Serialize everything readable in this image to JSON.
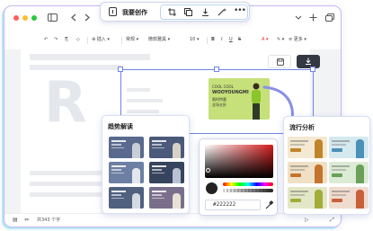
{
  "floating_toolbar": {
    "label": "我要创作"
  },
  "format_toolbar": {
    "insert_label": "插入",
    "font_label": "常规",
    "font_family": "微软雅黑",
    "font_size": "10",
    "more_label": "更多"
  },
  "canvas": {
    "watermark": "R"
  },
  "banner": {
    "line1": "COOL COOL",
    "line2": "WOOYOUNGMI",
    "line3": "限时特惠",
    "line4": "全场五折",
    "colors": {
      "background": "#c6e07a",
      "figure": "#8bc52c"
    }
  },
  "trend_panel": {
    "title": "趋势解读",
    "thumb_colors": [
      "#5a6a8e",
      "#4b5a7a",
      "#6d7fa3",
      "#37445e",
      "#50607f",
      "#7a6f8b"
    ]
  },
  "popular_panel": {
    "title": "流行分析",
    "card_colors": [
      "#f4e9d2",
      "#d6e9ef",
      "#efe0c6",
      "#dcebd5",
      "#e3e7c7",
      "#f0dccf"
    ],
    "accent_colors": [
      "#c0852a",
      "#4a91b7",
      "#c5742b",
      "#6aa05b",
      "#a3ad3a",
      "#c8603c"
    ]
  },
  "color_picker": {
    "hex_value": "#222222"
  },
  "status_bar": {
    "word_count": "共343 个字"
  },
  "colors": {
    "window_border": "#c9b6f3",
    "selection": "#6f84e6",
    "traffic_red": "#ff5f57",
    "traffic_yellow": "#febc2e",
    "traffic_green": "#28c840"
  }
}
